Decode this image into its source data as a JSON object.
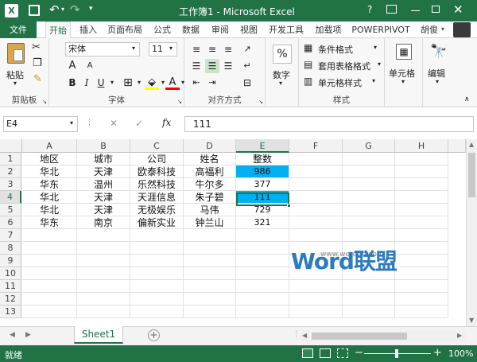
{
  "window": {
    "title": "工作簿1 - Microsoft Excel",
    "user": "胡俊"
  },
  "tabs": [
    "文件",
    "开始",
    "插入",
    "页面布局",
    "公式",
    "数据",
    "审阅",
    "视图",
    "开发工具",
    "加载项",
    "POWERPIVOT"
  ],
  "ribbon": {
    "clipboard": {
      "paste": "粘贴",
      "label": "剪贴板"
    },
    "font": {
      "name": "宋体",
      "size": "11",
      "increase": "A",
      "decrease": "A",
      "bold": "B",
      "italic": "I",
      "underline": "U",
      "label": "字体"
    },
    "align": {
      "label": "对齐方式"
    },
    "number": {
      "percent": "%",
      "label": "数字"
    },
    "styles": {
      "conditional": "条件格式",
      "table": "套用表格格式",
      "cell": "单元格样式",
      "label": "样式"
    },
    "cells": {
      "label": "单元格"
    },
    "edit": {
      "label": "编辑"
    }
  },
  "formula_bar": {
    "name_box": "E4",
    "fx": "fx",
    "value": "111",
    "cancel": "✕",
    "enter": "✓"
  },
  "columns": [
    "A",
    "B",
    "C",
    "D",
    "E",
    "F",
    "G",
    "H"
  ],
  "rows": [
    "1",
    "2",
    "3",
    "4",
    "5",
    "6",
    "7",
    "8",
    "9",
    "10",
    "11",
    "12",
    "13"
  ],
  "table": [
    [
      "地区",
      "城市",
      "公司",
      "姓名",
      "整数"
    ],
    [
      "华北",
      "天津",
      "欧泰科技",
      "高福利",
      "986"
    ],
    [
      "华东",
      "温州",
      "乐然科技",
      "牛尔多",
      "377"
    ],
    [
      "华北",
      "天津",
      "天涯信息",
      "朱子碧",
      "111"
    ],
    [
      "华北",
      "天津",
      "无极娱乐",
      "马伟",
      "729"
    ],
    [
      "华东",
      "南京",
      "偏新实业",
      "钟兰山",
      "321"
    ]
  ],
  "highlight_color": "#00b0f0",
  "watermark": {
    "brand": "Word联盟",
    "url": "www.wordlm.com"
  },
  "sheet_tabs": [
    "Sheet1"
  ],
  "status": {
    "mode": "就绪",
    "zoom": "100%",
    "minus": "−",
    "plus": "+"
  },
  "colors": {
    "accent": "#217346"
  }
}
